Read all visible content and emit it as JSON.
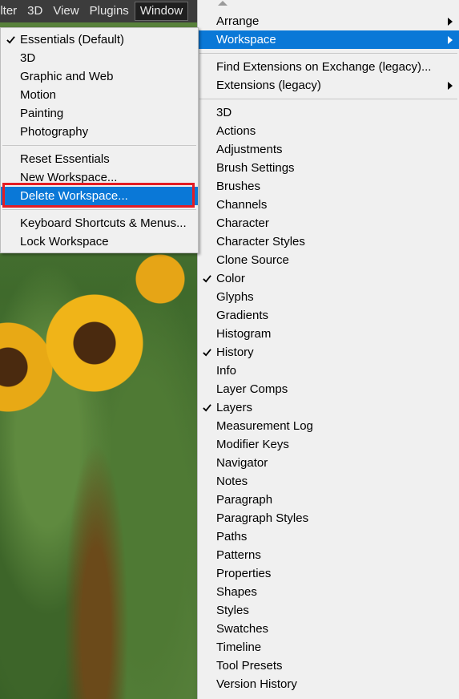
{
  "menubar": {
    "items": [
      "ilter",
      "3D",
      "View",
      "Plugins",
      "Window"
    ]
  },
  "workspace_submenu": {
    "items": [
      {
        "label": "Essentials (Default)",
        "checked": true
      },
      {
        "label": "3D"
      },
      {
        "label": "Graphic and Web"
      },
      {
        "label": "Motion"
      },
      {
        "label": "Painting"
      },
      {
        "label": "Photography"
      },
      {
        "label": "Reset Essentials"
      },
      {
        "label": "New Workspace..."
      },
      {
        "label": "Delete Workspace...",
        "highlighted": true
      },
      {
        "label": "Keyboard Shortcuts & Menus..."
      },
      {
        "label": "Lock Workspace"
      }
    ]
  },
  "window_menu": {
    "items": [
      {
        "label": "Arrange",
        "submenu": true
      },
      {
        "label": "Workspace",
        "submenu": true,
        "highlighted": true
      },
      {
        "label": "Find Extensions on Exchange (legacy)..."
      },
      {
        "label": "Extensions (legacy)",
        "submenu": true
      },
      {
        "label": "3D"
      },
      {
        "label": "Actions"
      },
      {
        "label": "Adjustments"
      },
      {
        "label": "Brush Settings"
      },
      {
        "label": "Brushes"
      },
      {
        "label": "Channels"
      },
      {
        "label": "Character"
      },
      {
        "label": "Character Styles"
      },
      {
        "label": "Clone Source"
      },
      {
        "label": "Color",
        "checked": true
      },
      {
        "label": "Glyphs"
      },
      {
        "label": "Gradients"
      },
      {
        "label": "Histogram"
      },
      {
        "label": "History",
        "checked": true
      },
      {
        "label": "Info"
      },
      {
        "label": "Layer Comps"
      },
      {
        "label": "Layers",
        "checked": true
      },
      {
        "label": "Measurement Log"
      },
      {
        "label": "Modifier Keys"
      },
      {
        "label": "Navigator"
      },
      {
        "label": "Notes"
      },
      {
        "label": "Paragraph"
      },
      {
        "label": "Paragraph Styles"
      },
      {
        "label": "Paths"
      },
      {
        "label": "Patterns"
      },
      {
        "label": "Properties"
      },
      {
        "label": "Shapes"
      },
      {
        "label": "Styles"
      },
      {
        "label": "Swatches"
      },
      {
        "label": "Timeline"
      },
      {
        "label": "Tool Presets"
      },
      {
        "label": "Version History"
      }
    ]
  },
  "colors": {
    "menu_bg": "#f0f0f0",
    "highlight": "#0a78d7",
    "callout_border": "#e51c23",
    "menubar_bg": "#3c3c3c"
  }
}
